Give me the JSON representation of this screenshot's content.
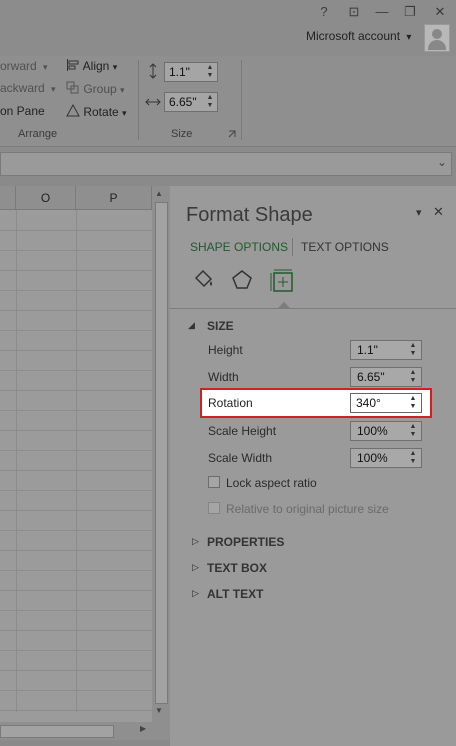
{
  "window": {
    "help_glyph": "?",
    "restore_glyph": "⊡",
    "minimize_glyph": "—",
    "maximize_glyph": "❐",
    "close_glyph": "✕",
    "account": "Microsoft account",
    "account_caret": "▾"
  },
  "ribbon": {
    "forward": "orward",
    "backward": "ackward",
    "selection_pane": "on Pane",
    "align": "Align",
    "group": "Group",
    "rotate": "Rotate",
    "arrange_label": "Arrange",
    "size_label": "Size",
    "height_value": "1.1\"",
    "width_value": "6.65\"",
    "dropdown_caret": "▾"
  },
  "sheet": {
    "columns": [
      "O",
      "P"
    ]
  },
  "pane": {
    "title": "Format Shape",
    "pin_glyph": "▾",
    "close_glyph": "✕",
    "tab_shape": "SHAPE OPTIONS",
    "tab_text": "TEXT OPTIONS",
    "size_section": "SIZE",
    "rows": [
      {
        "label": "Height",
        "value": "1.1\""
      },
      {
        "label": "Width",
        "value": "6.65\""
      },
      {
        "label": "Rotation",
        "value": "340°"
      },
      {
        "label": "Scale Height",
        "value": "100%"
      },
      {
        "label": "Scale Width",
        "value": "100%"
      }
    ],
    "lock_aspect": "Lock aspect ratio",
    "relative_original": "Relative to original picture size",
    "sections": [
      "PROPERTIES",
      "TEXT BOX",
      "ALT TEXT"
    ],
    "expanded_glyph": "◢",
    "collapsed_glyph": "▷"
  },
  "colors": {
    "highlight_border": "#d11f25",
    "tab_active": "#1f5a2d"
  }
}
